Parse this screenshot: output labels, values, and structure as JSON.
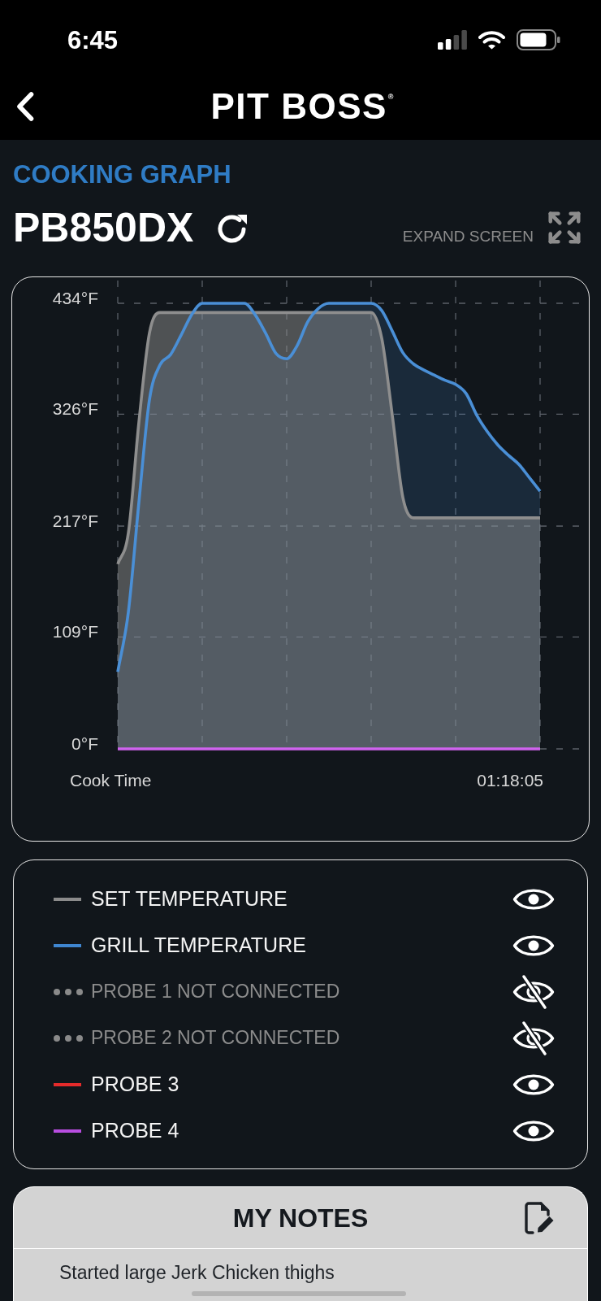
{
  "status_bar": {
    "time": "6:45"
  },
  "nav_bar": {
    "logo": "PIT BOSS$^{®}$"
  },
  "page": {
    "section_title": "COOKING GRAPH",
    "device_name": "PB850DX",
    "expand_label": "EXPAND SCREEN"
  },
  "graph": {
    "chart_data": {
      "type": "line",
      "xlabel": "Cook Time",
      "ylim": [
        0,
        434
      ],
      "yticks": [
        {
          "value": 434,
          "label": "434°F"
        },
        {
          "value": 326,
          "label": "326°F"
        },
        {
          "value": 217,
          "label": "217°F"
        },
        {
          "value": 109,
          "label": "109°F"
        },
        {
          "value": 0,
          "label": "0°F"
        }
      ],
      "grid": true,
      "series": [
        {
          "type": "area",
          "color": "#8e8e8e",
          "values": [
            180,
            210,
            318,
            405,
            425,
            425,
            425,
            425,
            425,
            425,
            425,
            425,
            425,
            425,
            425,
            425,
            425,
            425,
            425,
            425,
            425,
            425,
            425,
            425,
            425,
            400,
            325,
            245,
            225,
            225,
            225,
            225,
            225,
            225,
            225,
            225,
            225,
            225,
            225,
            225,
            225
          ]
        },
        {
          "type": "area",
          "color": "#4a8fd6",
          "values": [
            75,
            133,
            240,
            340,
            374,
            384,
            403,
            423,
            434,
            434,
            434,
            434,
            434,
            423,
            405,
            385,
            380,
            393,
            416,
            429,
            434,
            434,
            434,
            434,
            434,
            427,
            407,
            386,
            375,
            369,
            364,
            359,
            355,
            346,
            325,
            309,
            296,
            286,
            277,
            264,
            251
          ]
        },
        {
          "color": "#cf63ee",
          "values": [
            0,
            0,
            0,
            0,
            0,
            0,
            0,
            0,
            0,
            0,
            0,
            0,
            0,
            0,
            0,
            0,
            0,
            0,
            0,
            0,
            0,
            0,
            0,
            0,
            0,
            0,
            0,
            0,
            0,
            0,
            0,
            0,
            0,
            0,
            0,
            0,
            0,
            0,
            0,
            0,
            0
          ]
        }
      ],
      "annotations": [
        "01:18:05"
      ]
    }
  },
  "legend": {
    "items": [
      {
        "label": "SET TEMPERATURE",
        "color": "#8b8b8b",
        "connected": true,
        "visible": true
      },
      {
        "label": "GRILL TEMPERATURE",
        "color": "#3f86d0",
        "connected": true,
        "visible": true
      },
      {
        "label": "PROBE 1 NOT CONNECTED",
        "color": "#8a8a8a",
        "connected": false,
        "visible": false
      },
      {
        "label": "PROBE 2 NOT CONNECTED",
        "color": "#8a8a8a",
        "connected": false,
        "visible": false
      },
      {
        "label": "PROBE 3",
        "color": "#e52b2b",
        "connected": true,
        "visible": true
      },
      {
        "label": "PROBE 4",
        "color": "#b84de0",
        "connected": true,
        "visible": true
      }
    ]
  },
  "notes": {
    "title": "MY NOTES",
    "entries": [
      "Started large Jerk Chicken thighs"
    ]
  }
}
